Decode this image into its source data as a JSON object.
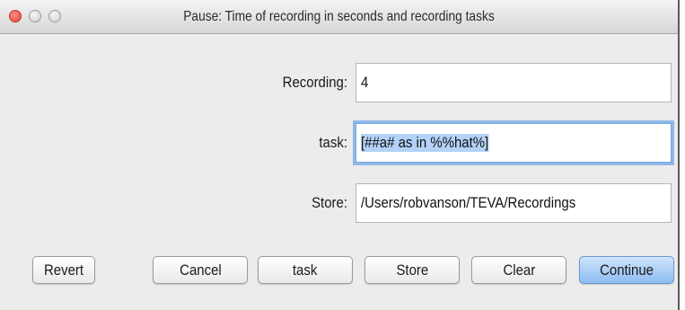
{
  "window": {
    "title": "Pause: Time of recording in seconds and recording tasks"
  },
  "form": {
    "recording": {
      "label": "Recording:",
      "value": "4"
    },
    "task": {
      "label": "task:",
      "value": "[##a# as in %%hat%]"
    },
    "store": {
      "label": "Store:",
      "value": "/Users/robvanson/TEVA/Recordings"
    }
  },
  "buttons": {
    "revert": "Revert",
    "cancel": "Cancel",
    "task": "task",
    "store": "Store",
    "clear": "Clear",
    "continue": "Continue"
  },
  "colors": {
    "close": "#e0443a",
    "focus_ring": "#8fb8e8",
    "selection": "#b3d2f7",
    "default_button": "#8dbdf2"
  }
}
